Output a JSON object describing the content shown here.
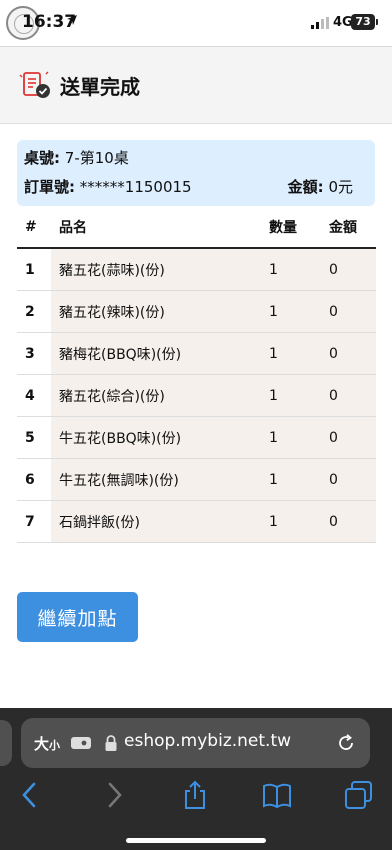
{
  "status_bar": {
    "time": "16:37",
    "network": "4G",
    "battery": "73"
  },
  "header": {
    "title": "送單完成"
  },
  "order": {
    "table_label": "桌號:",
    "table_value": "7-第10桌",
    "order_label": "訂單號:",
    "order_value": "******1150015",
    "amount_label": "金額:",
    "amount_value": "0元"
  },
  "table": {
    "headers": [
      "#",
      "品名",
      "數量",
      "金額"
    ],
    "rows": [
      [
        "1",
        "豬五花(蒜味)(份)",
        "1",
        "0"
      ],
      [
        "2",
        "豬五花(辣味)(份)",
        "1",
        "0"
      ],
      [
        "3",
        "豬梅花(BBQ味)(份)",
        "1",
        "0"
      ],
      [
        "4",
        "豬五花(綜合)(份)",
        "1",
        "0"
      ],
      [
        "5",
        "牛五花(BBQ味)(份)",
        "1",
        "0"
      ],
      [
        "6",
        "牛五花(無調味)(份)",
        "1",
        "0"
      ],
      [
        "7",
        "石鍋拌飯(份)",
        "1",
        "0"
      ]
    ]
  },
  "actions": {
    "continue_label": "繼續加點"
  },
  "browser": {
    "text_size_label": "大",
    "text_size_small": "小",
    "url": "eshop.mybiz.net.tw"
  },
  "icons": [
    "location-arrow-icon",
    "signal-icon",
    "battery-icon",
    "receipt-check-icon",
    "extension-icon",
    "lock-icon",
    "reload-icon",
    "back-icon",
    "forward-icon",
    "share-icon",
    "bookmarks-icon",
    "tabs-icon"
  ]
}
